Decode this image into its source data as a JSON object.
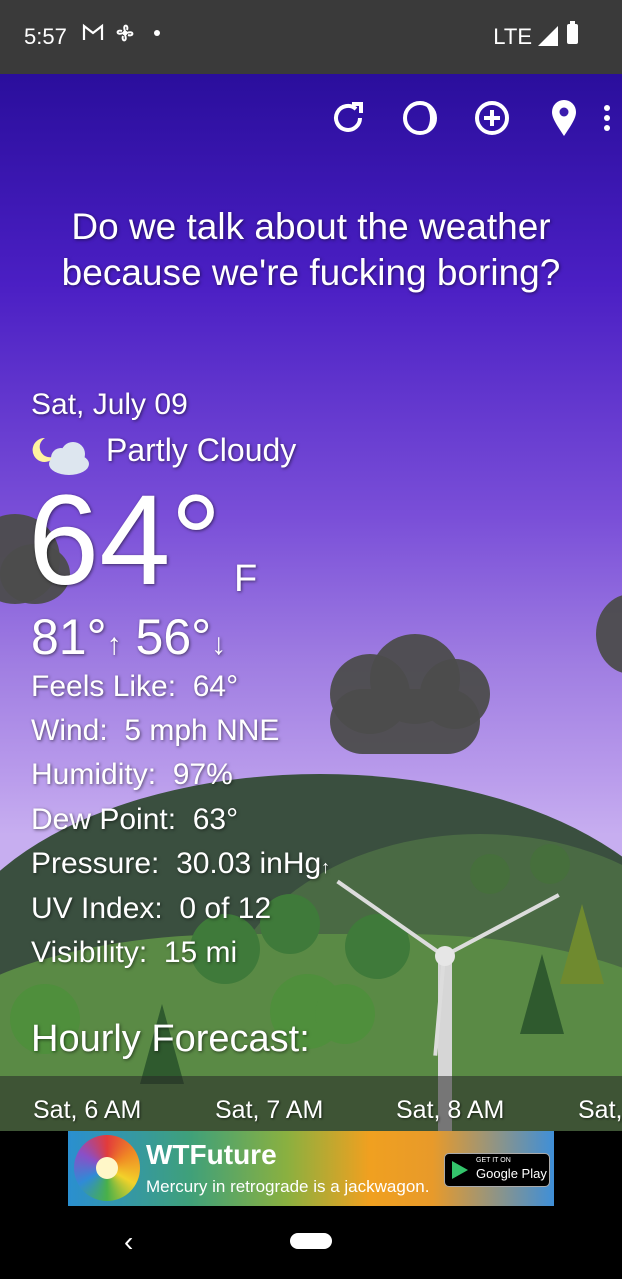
{
  "status_bar": {
    "time": "5:57",
    "network": "LTE",
    "notification_icons": [
      "gmail-icon",
      "fan-icon",
      "dot-icon"
    ]
  },
  "toolbar": {
    "icons": [
      "refresh-icon",
      "theme-icon",
      "add-location-icon",
      "location-pin-icon",
      "more-options-icon"
    ]
  },
  "quote": "Do we talk about the weather because we're fucking boring?",
  "weather": {
    "date": "Sat, July 09",
    "condition": "Partly Cloudy",
    "condition_icon": "partly-cloudy-night-icon",
    "temperature": "64°",
    "unit": "F",
    "high": "81°",
    "low": "56°",
    "details": [
      {
        "label": "Feels Like:",
        "value": "64°"
      },
      {
        "label": "Wind:",
        "value": "5 mph NNE"
      },
      {
        "label": "Humidity:",
        "value": "97%"
      },
      {
        "label": "Dew Point:",
        "value": "63°"
      },
      {
        "label": "Pressure:",
        "value": "30.03 inHg",
        "trend": "↑"
      },
      {
        "label": "UV Index:",
        "value": "0 of 12"
      },
      {
        "label": "Visibility:",
        "value": "15 mi"
      }
    ]
  },
  "hourly": {
    "title": "Hourly Forecast:",
    "items": [
      "Sat, 6 AM",
      "Sat, 7 AM",
      "Sat, 8 AM",
      "Sat,"
    ]
  },
  "ad": {
    "title": "WTFuture",
    "subtitle": "Mercury in retrograde is a jackwagon.",
    "badge_small": "GET IT ON",
    "badge_text": "Google Play"
  },
  "nav": {
    "back_icon": "back-icon",
    "home_icon": "home-pill-icon"
  },
  "colors": {
    "sky_top": "#2a0e9c",
    "sky_bottom": "#c7aef0",
    "status_bar": "#3a3a3a"
  }
}
